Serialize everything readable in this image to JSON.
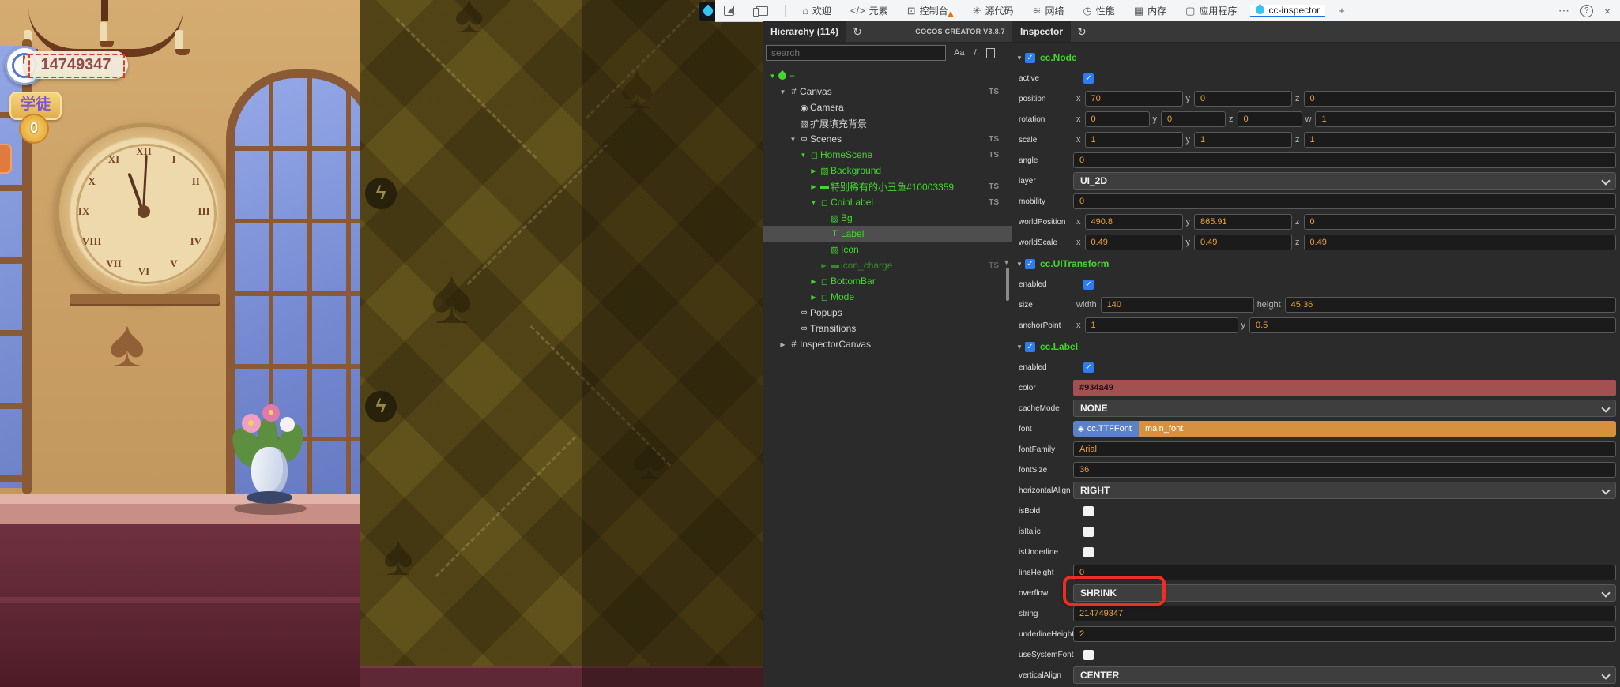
{
  "toolbar": {
    "tabs": [
      {
        "name": "inspect-element",
        "icon": "inspect",
        "label": ""
      },
      {
        "name": "device-toolbar",
        "icon": "device",
        "label": ""
      },
      {
        "name": "welcome",
        "icon": "⌂",
        "label": "欢迎"
      },
      {
        "name": "elements",
        "icon": "</>",
        "label": "元素"
      },
      {
        "name": "console",
        "icon": "⊡",
        "label": "控制台",
        "badge": true
      },
      {
        "name": "sources",
        "icon": "✳",
        "label": "源代码"
      },
      {
        "name": "network",
        "icon": "≋",
        "label": "网络"
      },
      {
        "name": "performance",
        "icon": "◷",
        "label": "性能"
      },
      {
        "name": "memory",
        "icon": "▦",
        "label": "内存"
      },
      {
        "name": "application",
        "icon": "▢",
        "label": "应用程序"
      },
      {
        "name": "cc-inspector",
        "icon": "drop",
        "label": "cc-inspector",
        "active": true
      },
      {
        "name": "new-tab",
        "icon": "+",
        "label": ""
      }
    ],
    "controls": [
      {
        "name": "more-options",
        "glyph": "⋯"
      },
      {
        "name": "help",
        "glyph": "?"
      },
      {
        "name": "close-devtools",
        "glyph": "×"
      }
    ]
  },
  "hierarchy": {
    "title": "Hierarchy (114)",
    "version": "COCOS CREATOR V3.8.7",
    "search_placeholder": "search",
    "tool_case": "Aa",
    "tool_regex": "/",
    "rows": [
      {
        "label": "−",
        "level": 0,
        "arrow": "down",
        "icon": "drop",
        "green": true
      },
      {
        "label": "Canvas",
        "level": 1,
        "arrow": "down",
        "icon": "canvas",
        "ts": true
      },
      {
        "label": "Camera",
        "level": 2,
        "icon": "camera"
      },
      {
        "label": "扩展填充背景",
        "level": 2,
        "icon": "image"
      },
      {
        "label": "Scenes",
        "level": 2,
        "arrow": "down",
        "icon": "scenes",
        "ts": true
      },
      {
        "label": "HomeScene",
        "level": 3,
        "arrow": "down",
        "icon": "node",
        "green": true,
        "ts": true
      },
      {
        "label": "Background",
        "level": 4,
        "arrow": "right",
        "icon": "image",
        "green": true
      },
      {
        "label": "特别稀有的小丑鱼#10003359",
        "level": 4,
        "arrow": "right",
        "icon": "prefab",
        "green": true,
        "ts": true
      },
      {
        "label": "CoinLabel",
        "level": 4,
        "arrow": "down",
        "icon": "node",
        "green": true,
        "ts": true
      },
      {
        "label": "Bg",
        "level": 5,
        "icon": "image",
        "green": true
      },
      {
        "label": "Label",
        "level": 5,
        "icon": "label",
        "green": true,
        "selected": true
      },
      {
        "label": "Icon",
        "level": 5,
        "icon": "image",
        "green": true
      },
      {
        "label": "icon_charge",
        "level": 5,
        "arrow": "right",
        "icon": "prefab",
        "green": true,
        "ts": true,
        "dim": true
      },
      {
        "label": "BottomBar",
        "level": 4,
        "arrow": "right",
        "icon": "node",
        "green": true
      },
      {
        "label": "Mode",
        "level": 4,
        "arrow": "right",
        "icon": "node",
        "green": true
      },
      {
        "label": "Popups",
        "level": 2,
        "icon": "scenes"
      },
      {
        "label": "Transitions",
        "level": 2,
        "icon": "scenes"
      },
      {
        "label": "InspectorCanvas",
        "level": 1,
        "arrow": "right",
        "icon": "canvas"
      }
    ]
  },
  "inspector": {
    "title": "Inspector",
    "rows": [
      {
        "type": "component",
        "label": "cc.Node"
      },
      {
        "type": "checkbox",
        "label": "active",
        "checked": true
      },
      {
        "type": "vec",
        "label": "position",
        "fields": [
          [
            "x",
            "70"
          ],
          [
            "y",
            "0"
          ],
          [
            "z",
            "0"
          ]
        ]
      },
      {
        "type": "vec",
        "label": "rotation",
        "fields": [
          [
            "x",
            "0"
          ],
          [
            "y",
            "0"
          ],
          [
            "z",
            "0"
          ],
          [
            "w",
            "1"
          ]
        ]
      },
      {
        "type": "vec",
        "label": "scale",
        "fields": [
          [
            "x",
            "1"
          ],
          [
            "y",
            "1"
          ],
          [
            "z",
            "1"
          ]
        ]
      },
      {
        "type": "input",
        "label": "angle",
        "value": "0"
      },
      {
        "type": "select",
        "label": "layer",
        "value": "UI_2D"
      },
      {
        "type": "input",
        "label": "mobility",
        "value": "0"
      },
      {
        "type": "vec",
        "label": "worldPosition",
        "fields": [
          [
            "x",
            "490.8"
          ],
          [
            "y",
            "865.91"
          ],
          [
            "z",
            "0"
          ]
        ]
      },
      {
        "type": "vec",
        "label": "worldScale",
        "fields": [
          [
            "x",
            "0.49"
          ],
          [
            "y",
            "0.49"
          ],
          [
            "z",
            "0.49"
          ]
        ]
      },
      {
        "type": "component",
        "label": "cc.UITransform"
      },
      {
        "type": "checkbox",
        "label": "enabled",
        "checked": true
      },
      {
        "type": "vec2",
        "label": "size",
        "fields": [
          [
            "width",
            "140"
          ],
          [
            "height",
            "45.36"
          ]
        ]
      },
      {
        "type": "vec2",
        "label": "anchorPoint",
        "fields": [
          [
            "x",
            "1"
          ],
          [
            "y",
            "0.5"
          ]
        ]
      },
      {
        "type": "component",
        "label": "cc.Label"
      },
      {
        "type": "checkbox",
        "label": "enabled",
        "checked": true
      },
      {
        "type": "color",
        "label": "color",
        "value": "#934a49",
        "swatch": "#a25150"
      },
      {
        "type": "select",
        "label": "cacheMode",
        "value": "NONE"
      },
      {
        "type": "asset",
        "label": "font",
        "chip": "cc.TTFFont",
        "value": "main_font"
      },
      {
        "type": "input",
        "label": "fontFamily",
        "value": "Arial"
      },
      {
        "type": "input",
        "label": "fontSize",
        "value": "36"
      },
      {
        "type": "select",
        "label": "horizontalAlign",
        "value": "RIGHT"
      },
      {
        "type": "checkbox",
        "label": "isBold",
        "checked": false
      },
      {
        "type": "checkbox",
        "label": "isItalic",
        "checked": false
      },
      {
        "type": "checkbox",
        "label": "isUnderline",
        "checked": false
      },
      {
        "type": "input",
        "label": "lineHeight",
        "value": "0"
      },
      {
        "type": "select",
        "label": "overflow",
        "value": "SHRINK",
        "highlight": true
      },
      {
        "type": "input",
        "label": "string",
        "value": "214749347"
      },
      {
        "type": "input",
        "label": "underlineHeight",
        "value": "2"
      },
      {
        "type": "checkbox",
        "label": "useSystemFont",
        "checked": false
      },
      {
        "type": "select",
        "label": "verticalAlign",
        "value": "CENTER"
      }
    ]
  },
  "game": {
    "coin_label": "14749347",
    "badge_label": "学徒",
    "badge_count": "0",
    "charge_glyph": "ϟ",
    "motif_glyph": "♠",
    "clock_numerals": [
      "XII",
      "I",
      "II",
      "III",
      "IV",
      "V",
      "VI",
      "VII",
      "VIII",
      "IX",
      "X",
      "XI"
    ]
  },
  "ui": {
    "arrow_down": "▼",
    "arrow_right": "▶",
    "check": "✓",
    "refresh": "↻",
    "ts_label": "TS",
    "icons": {
      "canvas": "#",
      "camera": "◉",
      "image": "▨",
      "scenes": "∞",
      "node": "◻",
      "prefab": "▬",
      "label": "T",
      "cube": "◈"
    }
  },
  "colors": {
    "node_green": "#44d62c",
    "value_orange": "#eea13b",
    "label_color_value": "#934a49",
    "highlight_red": "#ee2e24",
    "checkbox_blue": "#2d7df0",
    "font_chip_blue": "#5b82c8",
    "font_asset_orange": "#d6913f",
    "devtools_accent": "#1a73e8"
  }
}
